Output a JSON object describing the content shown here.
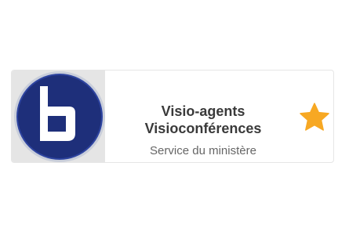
{
  "tile": {
    "logo_letter": "b",
    "title_line1": "Visio-agents",
    "title_line2": "Visioconférences",
    "subtitle": "Service du ministère",
    "favorite_icon": "star-icon",
    "colors": {
      "logo_blue": "#1e2f7a",
      "logo_ring": "#c9ceda",
      "logo_bg": "#e5e5e5",
      "star": "#f7a823",
      "title": "#3a3a3a",
      "subtitle": "#666666"
    }
  }
}
